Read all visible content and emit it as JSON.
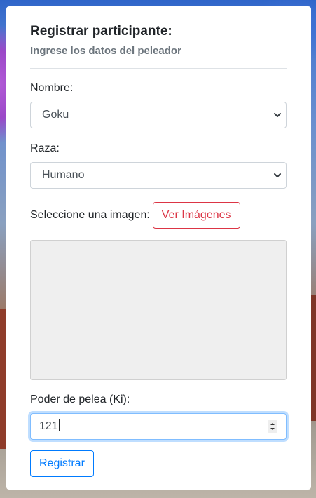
{
  "form": {
    "title": "Registrar participante:",
    "subtitle": "Ingrese los datos del peleador",
    "nombre_label": "Nombre:",
    "nombre_value": "Goku",
    "raza_label": "Raza:",
    "raza_value": "Humano",
    "imagen_label": "Seleccione una imagen:",
    "ver_imagenes_label": "Ver Imágenes",
    "ki_label": "Poder de pelea (Ki):",
    "ki_value": "121",
    "registrar_label": "Registrar"
  },
  "colors": {
    "danger": "#dc3545",
    "primary": "#007bff",
    "focus_border": "#80bdff",
    "subtitle": "#6c757d"
  },
  "icons": {
    "select_arrow": "chevron-down-icon",
    "number_spinner": "spinner-icon"
  }
}
